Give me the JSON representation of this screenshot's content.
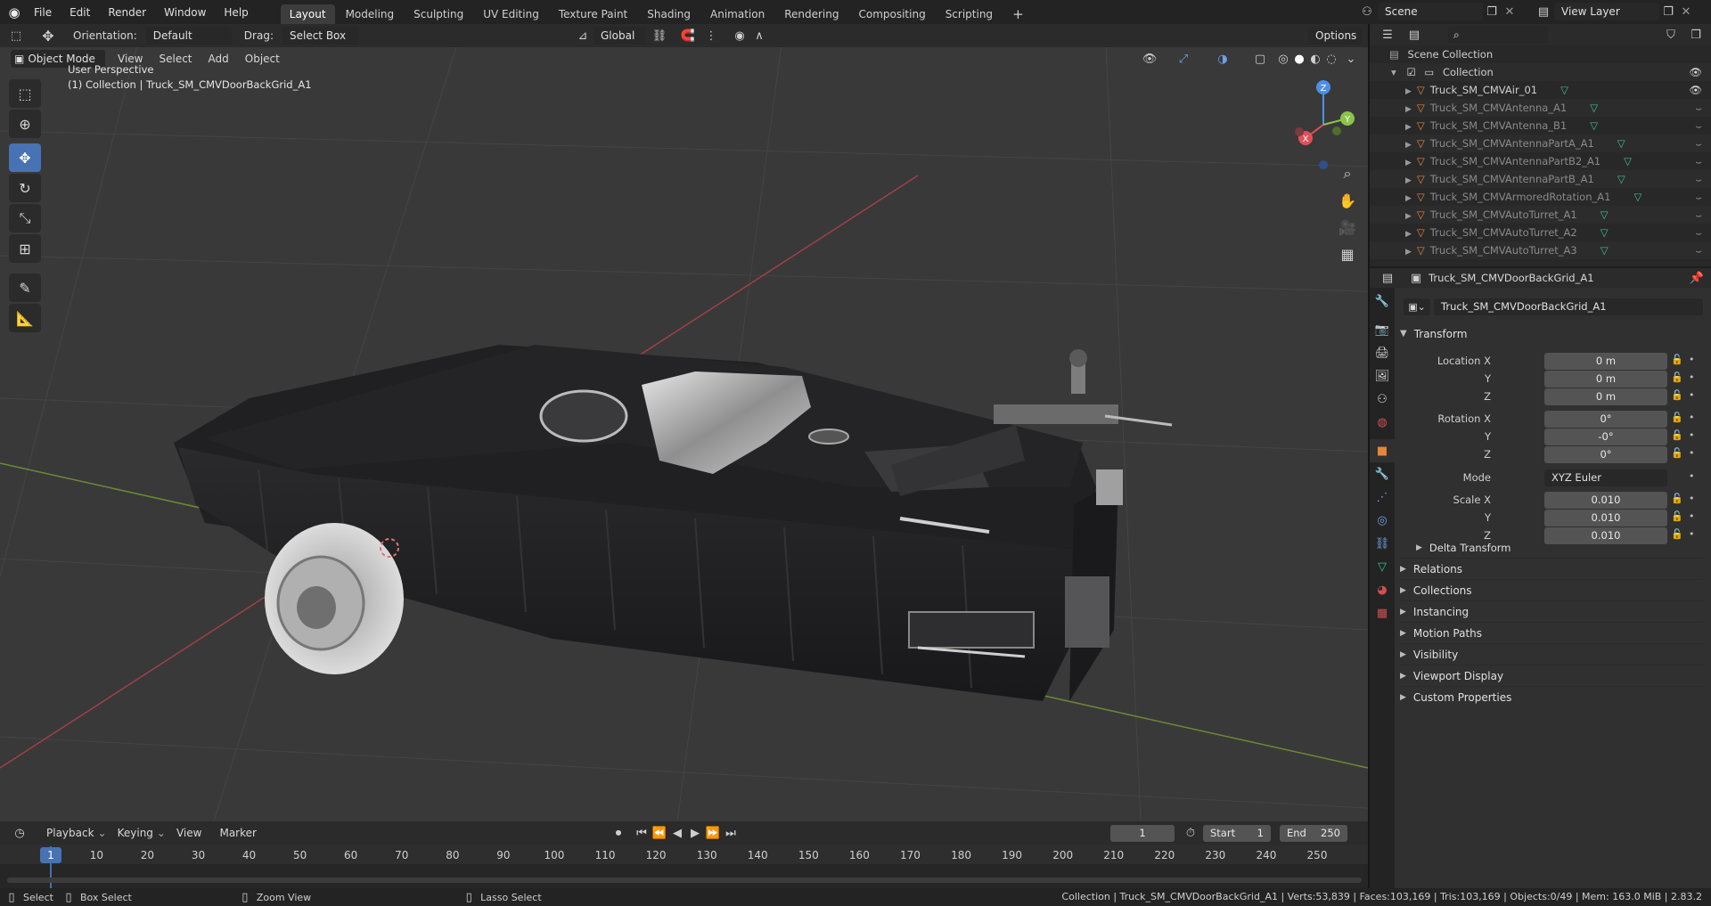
{
  "topbar": {
    "menus": [
      "File",
      "Edit",
      "Render",
      "Window",
      "Help"
    ],
    "workspaces": [
      "Layout",
      "Modeling",
      "Sculpting",
      "UV Editing",
      "Texture Paint",
      "Shading",
      "Animation",
      "Rendering",
      "Compositing",
      "Scripting"
    ],
    "add_tab": "+",
    "scene": "Scene",
    "view_layer": "View Layer"
  },
  "viewport_header": {
    "orientation_label": "Orientation:",
    "orientation_value": "Default",
    "drag_label": "Drag:",
    "drag_value": "Select Box",
    "transform_orientation": "Global",
    "options": "Options",
    "mode": "Object Mode",
    "menus": [
      "View",
      "Select",
      "Add",
      "Object"
    ]
  },
  "viewport": {
    "perspective": "User Perspective",
    "active_info": "(1) Collection | Truck_SM_CMVDoorBackGrid_A1",
    "gizmo": {
      "x": "X",
      "y": "Y",
      "z": "Z"
    }
  },
  "timeline": {
    "menus": [
      "Playback",
      "Keying",
      "View",
      "Marker"
    ],
    "current_frame": "1",
    "start_label": "Start",
    "start": "1",
    "end_label": "End",
    "end": "250",
    "ticks": [
      "1",
      "10",
      "20",
      "30",
      "40",
      "50",
      "60",
      "70",
      "80",
      "90",
      "100",
      "110",
      "120",
      "130",
      "140",
      "150",
      "160",
      "170",
      "180",
      "190",
      "200",
      "210",
      "220",
      "230",
      "240",
      "250"
    ]
  },
  "statusbar": {
    "select": "Select",
    "box_select": "Box Select",
    "zoom_view": "Zoom View",
    "lasso_select": "Lasso Select",
    "stats": "Collection | Truck_SM_CMVDoorBackGrid_A1 | Verts:53,839 | Faces:103,169 | Tris:103,169 | Objects:0/49 | Mem: 163.0 MiB | 2.83.2"
  },
  "outliner": {
    "scene_collection": "Scene Collection",
    "collection": "Collection",
    "items": [
      {
        "name": "Truck_SM_CMVAir_01",
        "dim": false
      },
      {
        "name": "Truck_SM_CMVAntenna_A1",
        "dim": true
      },
      {
        "name": "Truck_SM_CMVAntenna_B1",
        "dim": true
      },
      {
        "name": "Truck_SM_CMVAntennaPartA_A1",
        "dim": true
      },
      {
        "name": "Truck_SM_CMVAntennaPartB2_A1",
        "dim": true
      },
      {
        "name": "Truck_SM_CMVAntennaPartB_A1",
        "dim": true
      },
      {
        "name": "Truck_SM_CMVArmoredRotation_A1",
        "dim": true
      },
      {
        "name": "Truck_SM_CMVAutoTurret_A1",
        "dim": true
      },
      {
        "name": "Truck_SM_CMVAutoTurret_A2",
        "dim": true
      },
      {
        "name": "Truck_SM_CMVAutoTurret_A3",
        "dim": true
      }
    ]
  },
  "properties": {
    "header_object": "Truck_SM_CMVDoorBackGrid_A1",
    "object_name": "Truck_SM_CMVDoorBackGrid_A1",
    "transform_title": "Transform",
    "location_x_label": "Location X",
    "y_label": "Y",
    "z_label": "Z",
    "location": [
      "0 m",
      "0 m",
      "0 m"
    ],
    "rotation_x_label": "Rotation X",
    "rotation": [
      "0°",
      "-0°",
      "0°"
    ],
    "mode_label": "Mode",
    "mode_value": "XYZ Euler",
    "scale_x_label": "Scale X",
    "scale": [
      "0.010",
      "0.010",
      "0.010"
    ],
    "delta_transform": "Delta Transform",
    "panels": [
      "Relations",
      "Collections",
      "Instancing",
      "Motion Paths",
      "Visibility",
      "Viewport Display",
      "Custom Properties"
    ]
  },
  "colors": {
    "accent": "#4772b3",
    "x_axis": "#e0505a",
    "y_axis": "#8bc34a",
    "z_axis": "#4f8ee8",
    "mesh_icon": "#e5863a",
    "data_icon": "#3fbf8f"
  }
}
